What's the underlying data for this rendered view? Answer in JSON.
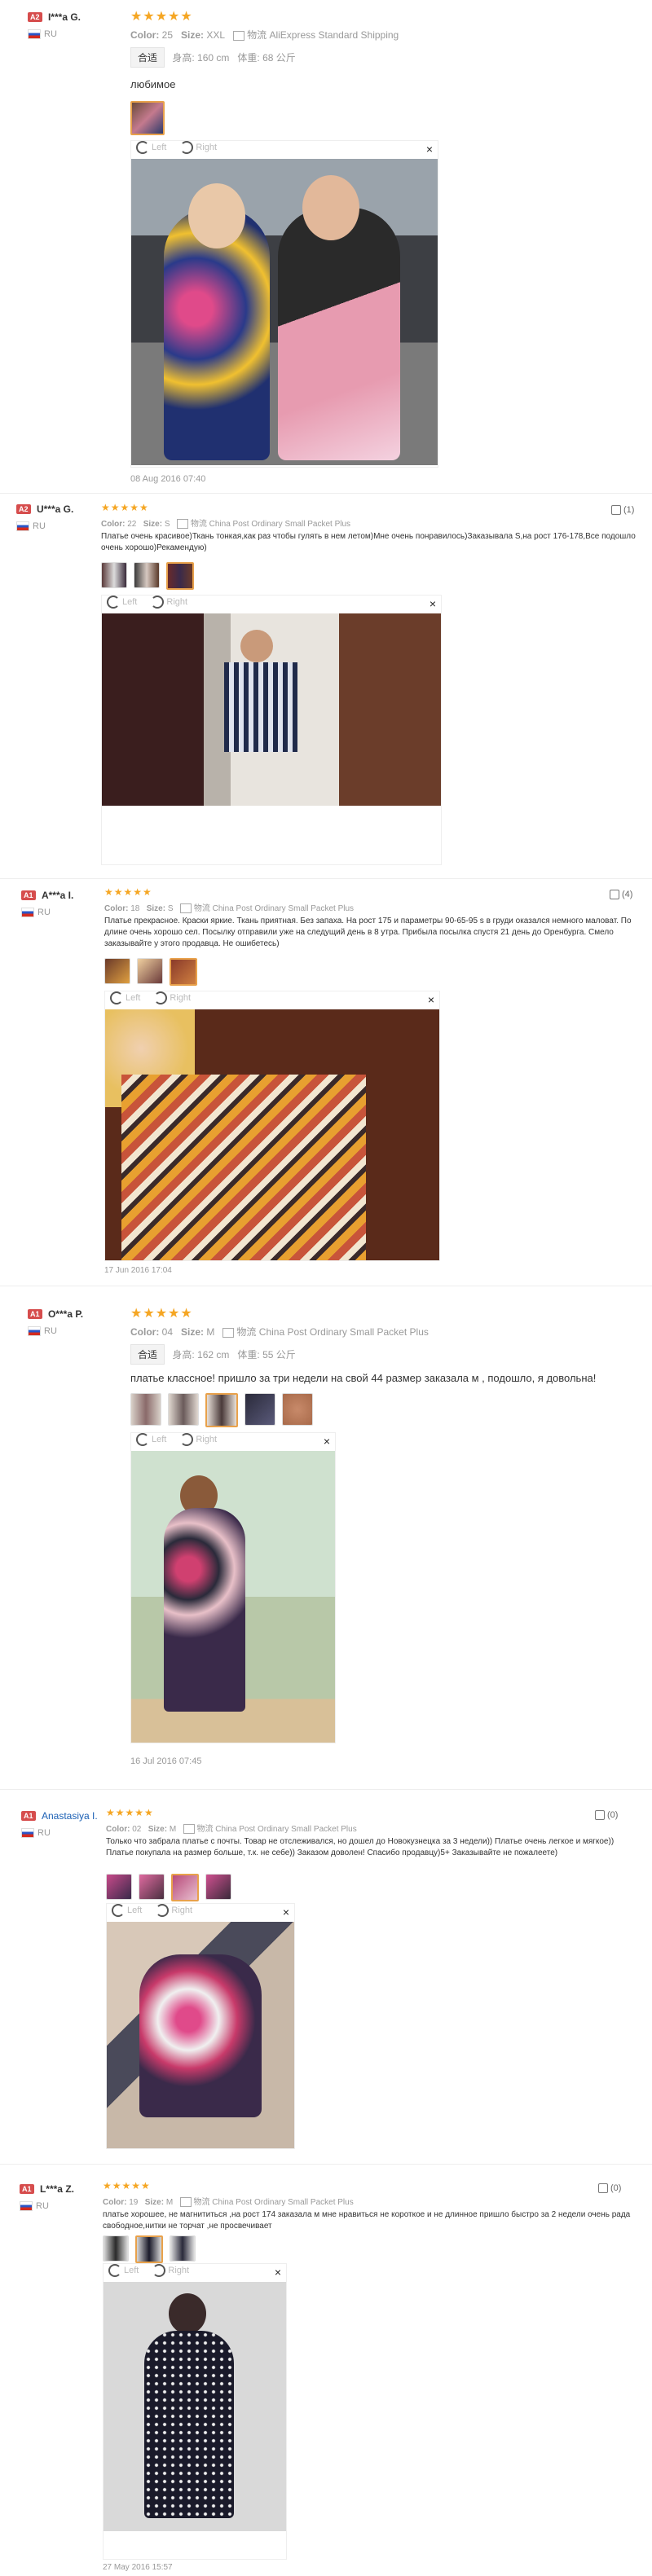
{
  "reviews": [
    {
      "level": "A2",
      "name": "I***a G.",
      "country": "RU",
      "stars": "★★★★★",
      "color_label": "Color:",
      "color": "25",
      "size_label": "Size:",
      "size": "XXL",
      "shipping": "AliExpress Standard Shipping",
      "body_tag": "合适",
      "height": "身高: 160 cm",
      "weight": "体重: 68 公斤",
      "text": "любимое",
      "viewer": {
        "left": "Left",
        "right": "Right"
      },
      "date": "08 Aug 2016 07:40"
    },
    {
      "level": "A2",
      "name": "U***a G.",
      "country": "RU",
      "stars": "★★★★★",
      "color_label": "Color:",
      "color": "22",
      "size_label": "Size:",
      "size": "S",
      "shipping": "China Post Ordinary Small Packet Plus",
      "text": "Платье очень красивое)Ткань тонкая,как раз чтобы гулять в нем летом)Мне очень понравилось)Заказывала S,на рост 176-178,Все подошло очень хорошо)Рекамендую)",
      "viewer": {
        "left": "Left",
        "right": "Right"
      },
      "helpful": "(1)"
    },
    {
      "level": "A1",
      "name": "A***a I.",
      "country": "RU",
      "stars": "★★★★★",
      "color_label": "Color:",
      "color": "18",
      "size_label": "Size:",
      "size": "S",
      "shipping": "China Post Ordinary Small Packet Plus",
      "text": "Платье прекрасное. Краски яркие. Ткань приятная. Без запаха. На рост 175 и параметры 90-65-95 s в груди оказался немного маловат. По длине очень хорошо сел. Посылку отправили уже на следущий день в 8 утра. Прибыла посылка спустя 21 день до Оренбурга. Смело заказывайте у этого продавца. Не ошибетесь)",
      "viewer": {
        "left": "Left",
        "right": "Right"
      },
      "date": "17 Jun 2016 17:04",
      "helpful": "(4)"
    },
    {
      "level": "A1",
      "name": "O***a P.",
      "country": "RU",
      "stars": "★★★★★",
      "color_label": "Color:",
      "color": "04",
      "size_label": "Size:",
      "size": "M",
      "shipping": "China Post Ordinary Small Packet Plus",
      "body_tag": "合适",
      "height": "身高: 162 cm",
      "weight": "体重: 55 公斤",
      "text": "платье классное! пришло за три недели на свой 44 размер заказала м , подошло, я довольна!",
      "viewer": {
        "left": "Left",
        "right": "Right"
      },
      "date": "16 Jul 2016 07:45"
    },
    {
      "level": "A1",
      "name": "Anastasiya I.",
      "country": "RU",
      "stars": "★★★★★",
      "color_label": "Color:",
      "color": "02",
      "size_label": "Size:",
      "size": "M",
      "shipping": "China Post Ordinary Small Packet Plus",
      "text": "Только что забрала платье с почты. Товар не отслеживался, но дошел до Новокузнецка за 3 недели)) Платье очень легкое и мягкое)) Платье покупала на размер больше, т.к. не себе)) Заказом доволен! Спасибо продавцу)5+ Заказывайте не пожалеете)",
      "viewer": {
        "left": "Left",
        "right": "Right"
      },
      "helpful": "(0)"
    },
    {
      "level": "A1",
      "name": "L***a Z.",
      "country": "RU",
      "stars": "★★★★★",
      "color_label": "Color:",
      "color": "19",
      "size_label": "Size:",
      "size": "M",
      "shipping": "China Post Ordinary Small Packet Plus",
      "text": "платье хорошее, не магнититься ,на рост 174 заказала м мне нравиться не короткое и не длинное пришло быстро за 2 недели очень рада свободное,нитки не торчат ,не просвечивает",
      "viewer": {
        "left": "Left",
        "right": "Right"
      },
      "date": "27 May 2016 15:57",
      "helpful": "(0)"
    }
  ],
  "colors": {
    "star": "#f5a623",
    "level_badge": "#d64d4d",
    "link": "#1a5fb4"
  }
}
